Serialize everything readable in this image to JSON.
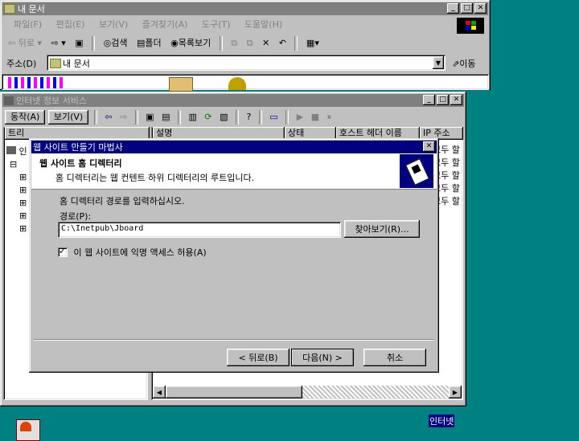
{
  "explorer": {
    "title": "내 문서",
    "menu": [
      "파일(F)",
      "편집(E)",
      "보기(V)",
      "즐겨찾기(A)",
      "도구(T)",
      "도움말(H)"
    ],
    "toolbar": {
      "back": "뒤로",
      "search": "검색",
      "folders": "폴더",
      "history": "목록보기"
    },
    "address_label": "주소(D)",
    "address_value": "내 문서",
    "go": "이동"
  },
  "iis": {
    "title": "인터넷 정보 서비스",
    "menu": [
      "동작(A)",
      "보기(V)"
    ],
    "tree_header": "트리",
    "tree_root": "인",
    "columns": [
      "설명",
      "상태",
      "호스트 헤더 이름",
      "IP 주소"
    ],
    "ip_cells": [
      "모두 할",
      "모두 할",
      "모두 할",
      "모두 할",
      "모두 할"
    ]
  },
  "wizard": {
    "title": "웹 사이트 만들기 마법사",
    "heading": "웹 사이트 홈 디렉터리",
    "subheading": "홈 디렉터리는 웹 컨텐트 하위 디렉터리의 루트입니다.",
    "instruction": "홈 디렉터리 경로를 입력하십시오.",
    "path_label": "경로(P):",
    "path_value": "C:\\Inetpub\\Jboard",
    "browse_label": "찾아보기(R)...",
    "anon_label": "이 웹 사이트에 익명 액세스 허용(A)",
    "anon_checked": true,
    "back_label": "< 뒤로(B)",
    "next_label": "다음(N) >",
    "cancel_label": "취소"
  },
  "desktop": {
    "label": "인터넷"
  }
}
